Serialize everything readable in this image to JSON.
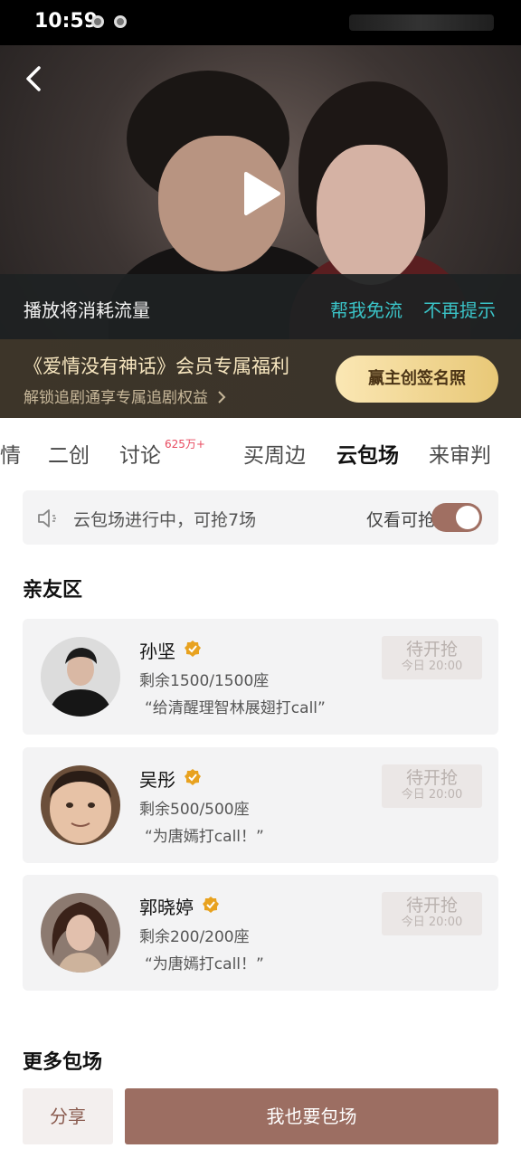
{
  "status_bar": {
    "time": "10:59"
  },
  "video": {
    "flow_notice": "播放将消耗流量",
    "free_link": "帮我免流",
    "no_more_link": "不再提示"
  },
  "promo": {
    "title": "《爱情没有神话》会员专属福利",
    "subtitle": "解锁追剧通享专属追剧权益",
    "button": "赢主创签名照"
  },
  "tabs": [
    {
      "label": "情"
    },
    {
      "label": "二创"
    },
    {
      "label": "讨论",
      "badge": "625万+"
    },
    {
      "label": "买周边"
    },
    {
      "label": "云包场",
      "active": true
    },
    {
      "label": "来审判"
    }
  ],
  "notice": {
    "text": "云包场进行中，可抢7场",
    "filter_label": "仅看可抢",
    "filter_on": true
  },
  "sections": {
    "friends_title": "亲友区",
    "more_title": "更多包场"
  },
  "cards": [
    {
      "name": "孙坚",
      "seats": "剩余1500/1500座",
      "message": "“给清醒理智林展翅打call”",
      "button": "待开抢",
      "time": "今日 20:00"
    },
    {
      "name": "吴彤",
      "seats": "剩余500/500座",
      "message": "“为唐嫣打call！”",
      "button": "待开抢",
      "time": "今日 20:00"
    },
    {
      "name": "郭晓婷",
      "seats": "剩余200/200座",
      "message": "“为唐嫣打call！”",
      "button": "待开抢",
      "time": "今日 20:00"
    }
  ],
  "footer": {
    "share": "分享",
    "book": "我也要包场"
  },
  "colors": {
    "accent": "#9c6e62",
    "link": "#3ac2c6",
    "badge": "#e84a5f",
    "verify": "#e8a21f"
  }
}
